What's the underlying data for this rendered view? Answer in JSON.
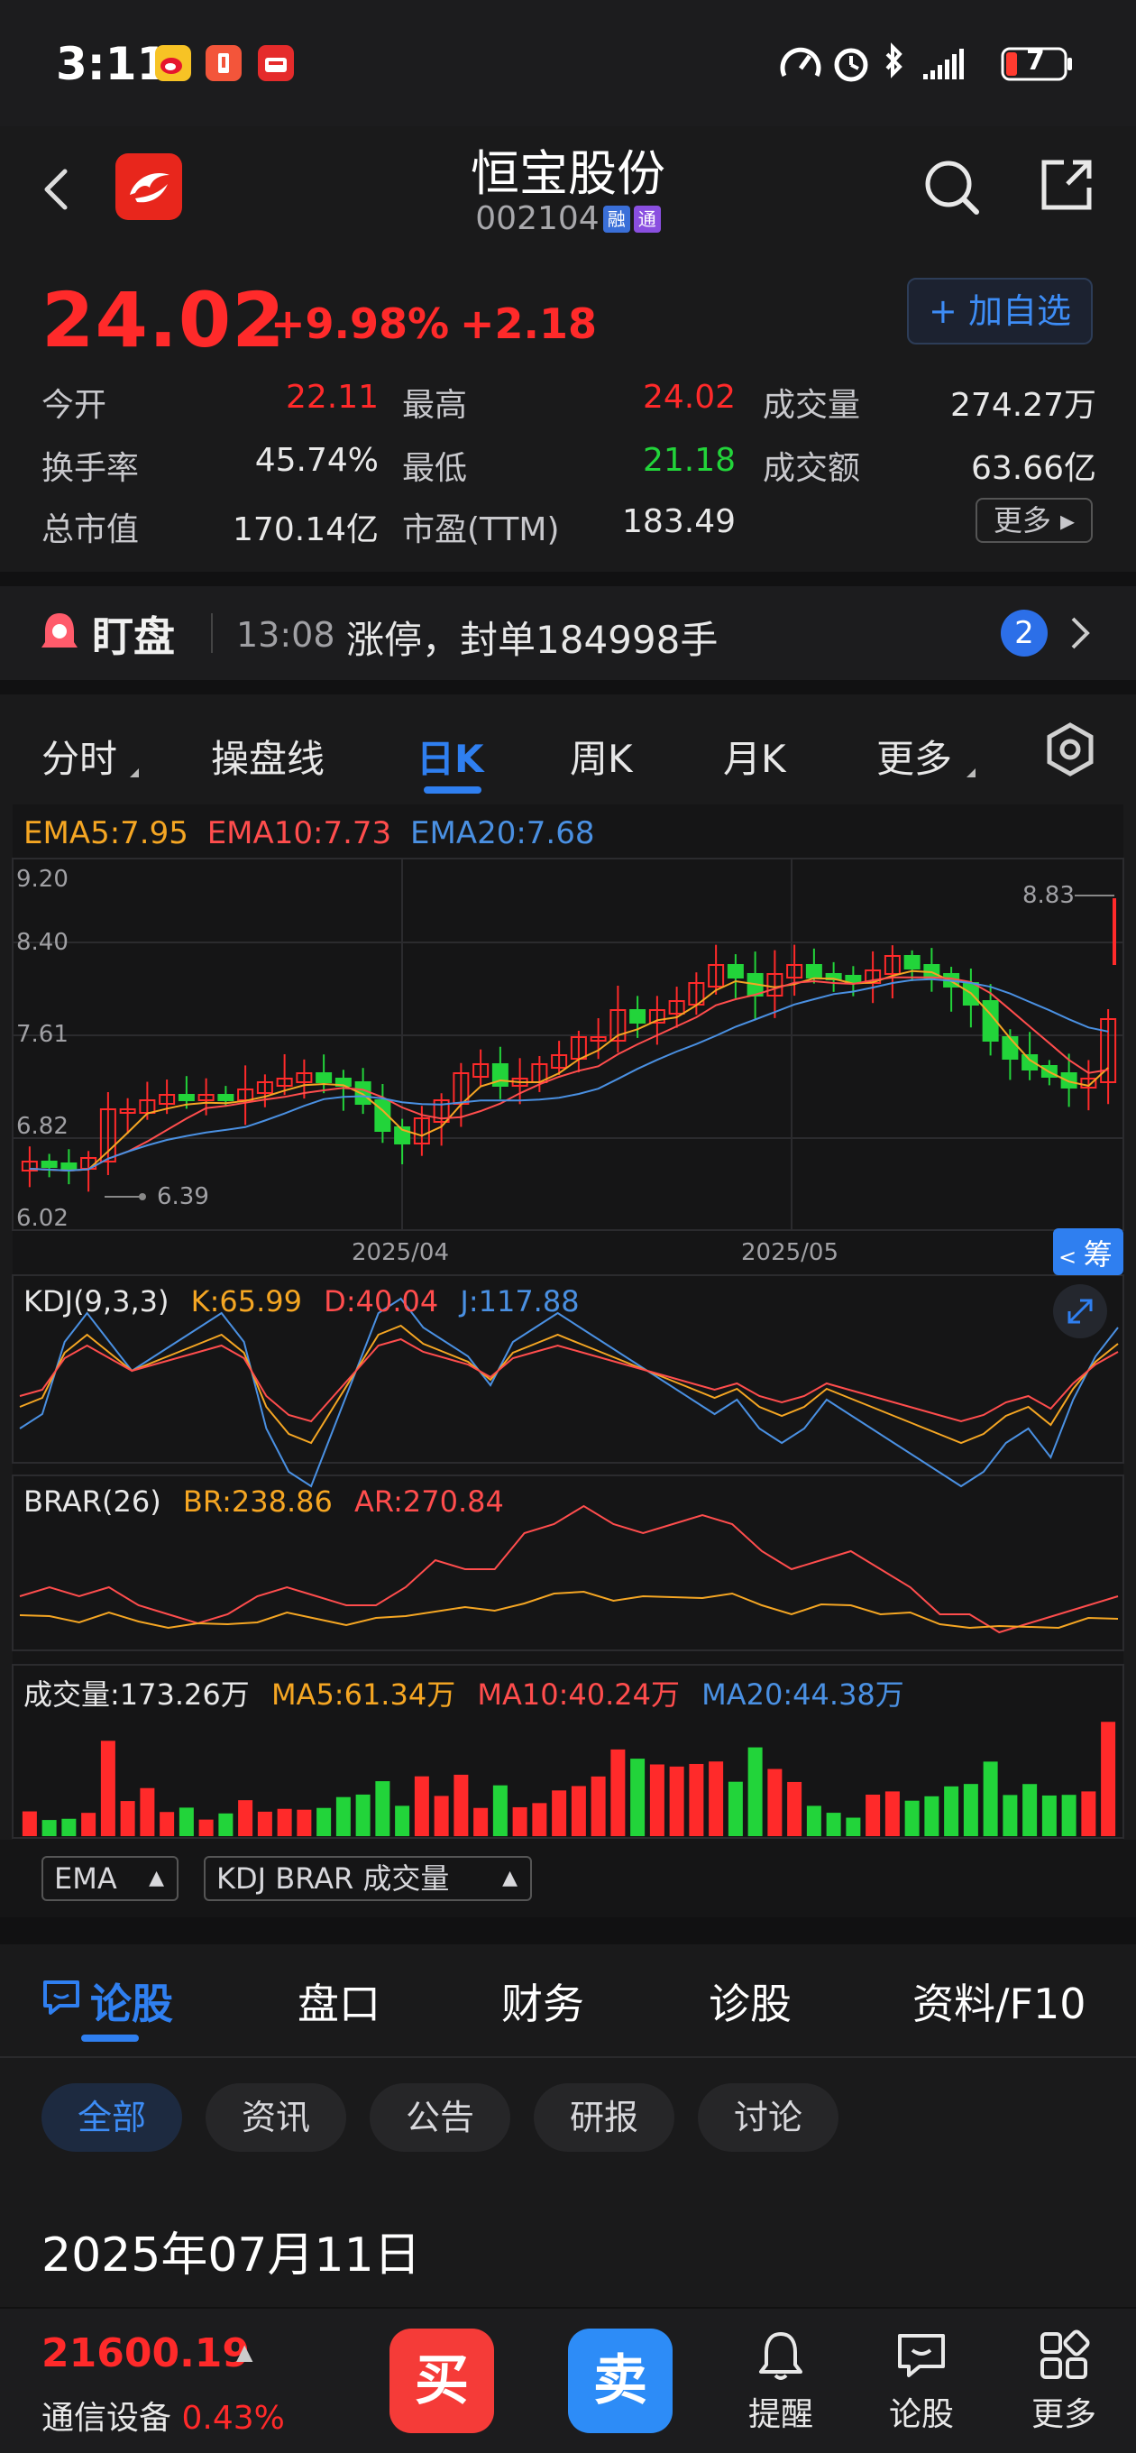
{
  "status_bar": {
    "time": "3:11",
    "battery": "7"
  },
  "header": {
    "stock_name": "恒宝股份",
    "stock_code": "002104",
    "tag_rong": "融",
    "tag_tong": "通"
  },
  "quote": {
    "price": "24.02",
    "change_pct": "+9.98%",
    "change": "+2.18",
    "watch_button": "+ 加自选",
    "more_button": "更多 ▸",
    "stats": [
      {
        "label": "今开",
        "value": "22.11",
        "color": "red"
      },
      {
        "label": "最高",
        "value": "24.02",
        "color": "red"
      },
      {
        "label": "成交量",
        "value": "274.27万",
        "color": "white"
      },
      {
        "label": "换手率",
        "value": "45.74%",
        "color": "white"
      },
      {
        "label": "最低",
        "value": "21.18",
        "color": "green"
      },
      {
        "label": "成交额",
        "value": "63.66亿",
        "color": "white"
      },
      {
        "label": "总市值",
        "value": "170.14亿",
        "color": "white"
      },
      {
        "label": "市盈(TTM)",
        "value": "183.49",
        "color": "white"
      }
    ]
  },
  "dingpan": {
    "title": "盯盘",
    "time": "13:08",
    "message": "涨停，封单184998手",
    "badge": "2"
  },
  "chart_tabs": [
    "分时",
    "操盘线",
    "日K",
    "周K",
    "月K",
    "更多"
  ],
  "active_chart_tab": "日K",
  "chart": {
    "ema_legend": {
      "ema5": "EMA5:7.95",
      "ema10": "EMA10:7.73",
      "ema20": "EMA20:7.68"
    },
    "y_ticks": [
      "9.20",
      "8.40",
      "7.61",
      "6.82",
      "6.02"
    ],
    "x_ticks": [
      "2025/04",
      "2025/05"
    ],
    "max_label": "8.83",
    "min_label": "6.39",
    "chip_button": "筹",
    "kdj_legend": {
      "name": "KDJ(9,3,3)",
      "k": "K:65.99",
      "d": "D:40.04",
      "j": "J:117.88"
    },
    "brar_legend": {
      "name": "BRAR(26)",
      "br": "BR:238.86",
      "ar": "AR:270.84"
    },
    "vol_legend": {
      "name": "成交量:173.26万",
      "ma5": "MA5:61.34万",
      "ma10": "MA10:40.24万",
      "ma20": "MA20:44.38万"
    },
    "selector_main": "EMA",
    "selector_sub": "KDJ BRAR 成交量",
    "colors": {
      "up": "#ff2a2a",
      "down": "#22d43a",
      "ema5": "#f5a623",
      "ema10": "#ff4d4d",
      "ema20": "#4a90e2"
    }
  },
  "bottom_tabs": [
    "论股",
    "盘口",
    "财务",
    "诊股",
    "资料/F10"
  ],
  "filter_chips": [
    "全部",
    "资讯",
    "公告",
    "研报",
    "讨论"
  ],
  "date_heading": "2025年07月11日",
  "footer": {
    "index_value": "21600.19",
    "index_name": "通信设备",
    "index_pct": "0.43%",
    "buy": "买",
    "sell": "卖",
    "nav": [
      "提醒",
      "论股",
      "更多"
    ]
  }
}
